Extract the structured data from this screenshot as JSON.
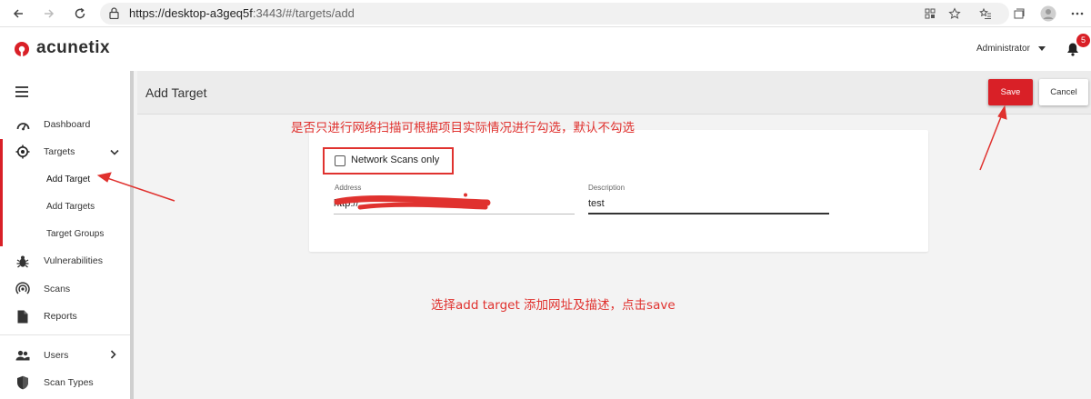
{
  "browser": {
    "url_host": "https://desktop-a3geq5f",
    "url_rest": ":3443/#/targets/add"
  },
  "header": {
    "logo_text": "acunetix",
    "user_name": "Administrator",
    "notification_count": "5"
  },
  "sidebar": {
    "items": [
      {
        "label": "Dashboard",
        "icon": "dashboard-icon"
      },
      {
        "label": "Targets",
        "icon": "target-icon"
      },
      {
        "label": "Add Target"
      },
      {
        "label": "Add Targets"
      },
      {
        "label": "Target Groups"
      },
      {
        "label": "Vulnerabilities",
        "icon": "bug-icon"
      },
      {
        "label": "Scans",
        "icon": "radar-icon"
      },
      {
        "label": "Reports",
        "icon": "report-icon"
      },
      {
        "label": "Users",
        "icon": "users-icon"
      },
      {
        "label": "Scan Types",
        "icon": "shield-icon"
      }
    ]
  },
  "page": {
    "title": "Add Target",
    "save_label": "Save",
    "cancel_label": "Cancel"
  },
  "form": {
    "network_scans_label": "Network Scans only",
    "network_scans_checked": false,
    "address_label": "Address",
    "address_value": "http://",
    "description_label": "Description",
    "description_value": "test"
  },
  "annotations": {
    "top_note": "是否只进行网络扫描可根据项目实际情况进行勾选，默认不勾选",
    "bottom_note": "选择add target 添加网址及描述，点击save"
  },
  "colors": {
    "accent": "#d92027",
    "annotation": "#e0322f"
  }
}
